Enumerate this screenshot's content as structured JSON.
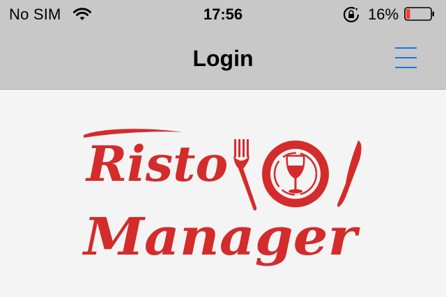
{
  "status_bar": {
    "carrier": "No SIM",
    "time": "17:56",
    "battery_percent": "16%",
    "battery_level": 0.16,
    "battery_color": "#ff3b30",
    "icons": [
      "wifi-icon",
      "orientation-lock-icon",
      "battery-icon"
    ]
  },
  "nav": {
    "title": "Login",
    "menu_icon": "hamburger-menu-icon",
    "accent": "#1677e8"
  },
  "logo": {
    "line1": "Risto",
    "line2": "Manager",
    "color": "#d42b2b",
    "icons": [
      "fork-icon",
      "plate-icon",
      "wine-glass-icon",
      "knife-icon"
    ]
  }
}
